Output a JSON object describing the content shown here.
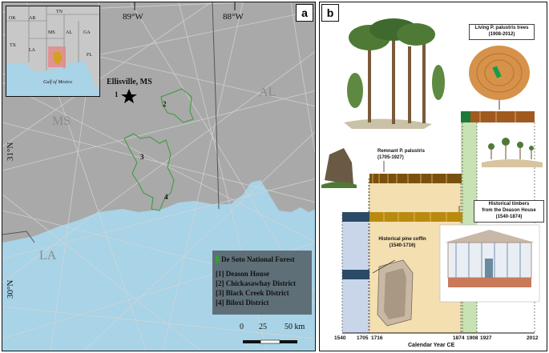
{
  "panel_a": {
    "label": "a",
    "inset": {
      "states": [
        "OK",
        "AR",
        "TN",
        "TX",
        "LA",
        "MS",
        "AL",
        "GA",
        "FL"
      ],
      "gulf": "Gulf of Mexico"
    },
    "longitudes": [
      "89°W",
      "88°W"
    ],
    "latitudes": [
      "31°N",
      "30°N"
    ],
    "states_big": [
      "MS",
      "AL",
      "LA"
    ],
    "site": {
      "name": "Ellisville, MS",
      "number": "1"
    },
    "districts": [
      "2",
      "3",
      "4"
    ],
    "legend": {
      "title": "De Soto National Forest",
      "items": [
        "[1] Deason House",
        "[2] Chickasawhay District",
        "[3] Black Creek District",
        "[4] Biloxi District"
      ]
    },
    "scale": {
      "labels": [
        "0",
        "25",
        "50 km"
      ]
    },
    "colors": {
      "land": "#a9a9a9",
      "water": "#a9d3e6",
      "forest": "#3a9a3a"
    }
  },
  "panel_b": {
    "label": "b",
    "living": {
      "title": "Living P. palustris trees",
      "years": "(1908-2012)"
    },
    "remnant": {
      "title": "Remnant P. palustris",
      "years": "(1705-1927)"
    },
    "timbers": {
      "title": "Historical timbers",
      "line2": "from the Deason House",
      "years": "(1540-1874)"
    },
    "coffin": {
      "title": "Historical pine coffin",
      "years": "(1540-1716)"
    },
    "axis": {
      "title": "Calendar Year CE",
      "ticks": [
        "1540",
        "1705",
        "1716",
        "1874",
        "1908",
        "1927",
        "2012"
      ]
    }
  }
}
